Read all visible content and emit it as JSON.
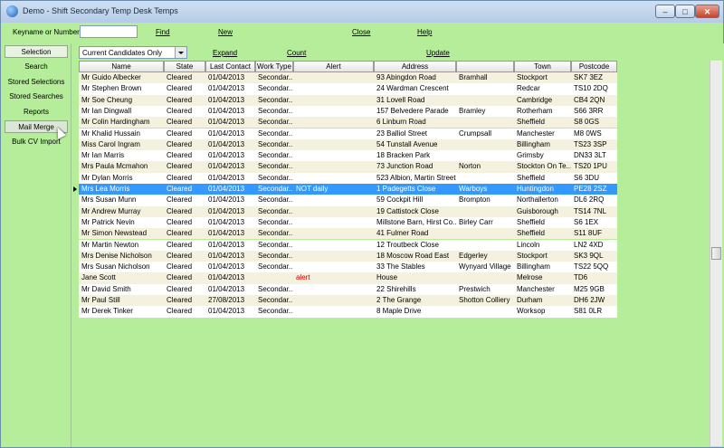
{
  "window": {
    "title": "Demo - Shift Secondary Temp Desk Temps",
    "minimize": "–",
    "maximize": "□",
    "close": "✕"
  },
  "toolbar": {
    "keyword_label": "Keyname or Number",
    "keyword_value": "",
    "find": "Find",
    "new": "New",
    "close": "Close",
    "help": "Help"
  },
  "sidebar": {
    "items": [
      "Selection",
      "Search",
      "Stored Selections",
      "Stored Searches",
      "Reports",
      "Mail Merge",
      "Bulk CV Import"
    ]
  },
  "filters": {
    "candidates_select": "Current Candidates Only",
    "expand": "Expand",
    "count": "Count",
    "update": "Update"
  },
  "table": {
    "columns": [
      "Name",
      "State",
      "Last Contact",
      "Work Type",
      "Alert",
      "Address",
      "",
      "Town",
      "Postcode"
    ],
    "rows": [
      [
        "Mr Guido Albecker",
        "Cleared",
        "01/04/2013",
        "Secondar...",
        "",
        "93 Abingdon Road",
        "Bramhall",
        "Stockport",
        "SK7 3EZ"
      ],
      [
        "Mr Stephen Brown",
        "Cleared",
        "01/04/2013",
        "Secondar...",
        "",
        "24 Wardman Crescent",
        "",
        "Redcar",
        "TS10 2DQ"
      ],
      [
        "Mr Soe Cheung",
        "Cleared",
        "01/04/2013",
        "Secondar...",
        "",
        "31 Lovell Road",
        "",
        "Cambridge",
        "CB4 2QN"
      ],
      [
        "Mr Ian Dingwall",
        "Cleared",
        "01/04/2013",
        "Secondar...",
        "",
        "157 Belvedere Parade",
        "Bramley",
        "Rotherham",
        "S66 3RR"
      ],
      [
        "Mr Colin Hardingham",
        "Cleared",
        "01/04/2013",
        "Secondar...",
        "",
        "6 Linburn Road",
        "",
        "Sheffield",
        "S8 0GS"
      ],
      [
        "Mr Khalid Hussain",
        "Cleared",
        "01/04/2013",
        "Secondar...",
        "",
        "23 Balliol Street",
        "Crumpsall",
        "Manchester",
        "M8 0WS"
      ],
      [
        "Miss Carol Ingram",
        "Cleared",
        "01/04/2013",
        "Secondar...",
        "",
        "54 Tunstall Avenue",
        "",
        "Billingham",
        "TS23 3SP"
      ],
      [
        "Mr Ian Marris",
        "Cleared",
        "01/04/2013",
        "Secondar...",
        "",
        "18 Bracken Park",
        "",
        "Grimsby",
        "DN33 3LT"
      ],
      [
        "Mrs Paula Mcmahon",
        "Cleared",
        "01/04/2013",
        "Secondar...",
        "",
        "73 Junction Road",
        "Norton",
        "Stockton On Te...",
        "TS20 1PU"
      ],
      [
        "Mr Dylan Morris",
        "Cleared",
        "01/04/2013",
        "Secondar...",
        "",
        "523 Albion, Martin Street",
        "",
        "Sheffield",
        "S6 3DU"
      ],
      [
        "Mrs Lea Morris",
        "Cleared",
        "01/04/2013",
        "Secondar...",
        "NOT daily",
        "1 Padegetts Close",
        "Warboys",
        "Huntingdon",
        "PE28 2SZ"
      ],
      [
        "Mrs Susan Munn",
        "Cleared",
        "01/04/2013",
        "Secondar...",
        "",
        "59 Cockpit Hill",
        "Brompton",
        "Northallerton",
        "DL6 2RQ"
      ],
      [
        "Mr Andrew Murray",
        "Cleared",
        "01/04/2013",
        "Secondar...",
        "",
        "19 Cattistock Close",
        "",
        "Guisborough",
        "TS14 7NL"
      ],
      [
        "Mr Patrick Nevin",
        "Cleared",
        "01/04/2013",
        "Secondar...",
        "",
        "Millstone Barn, Hirst Co...",
        "Birley Carr",
        "Sheffield",
        "S6 1EX"
      ],
      [
        "Mr Simon Newstead",
        "Cleared",
        "01/04/2013",
        "Secondar...",
        "",
        "41 Fulmer Road",
        "",
        "Sheffield",
        "S11 8UF"
      ],
      [
        "Mr Martin Newton",
        "Cleared",
        "01/04/2013",
        "Secondar...",
        "",
        "12 Troutbeck Close",
        "",
        "Lincoln",
        "LN2 4XD"
      ],
      [
        "Mrs Denise Nicholson",
        "Cleared",
        "01/04/2013",
        "Secondar...",
        "",
        "18 Moscow Road East",
        "Edgerley",
        "Stockport",
        "SK3 9QL"
      ],
      [
        "Mrs Susan Nicholson",
        "Cleared",
        "01/04/2013",
        "Secondar...",
        "",
        "33 The Stables",
        "Wynyard Village",
        "Billingham",
        "TS22 5QQ"
      ],
      [
        "Jane Scott",
        "Cleared",
        "01/04/2013",
        "",
        "alert",
        "House",
        "",
        "Melrose",
        "TD6"
      ],
      [
        "Mr David Smith",
        "Cleared",
        "01/04/2013",
        "Secondar...",
        "",
        "22 Shirehills",
        "Prestwich",
        "Manchester",
        "M25 9GB"
      ],
      [
        "Mr Paul Still",
        "Cleared",
        "27/08/2013",
        "Secondar...",
        "",
        "2 The Grange",
        "Shotton Colliery",
        "Durham",
        "DH6 2JW"
      ],
      [
        "Mr Derek Tinker",
        "Cleared",
        "01/04/2013",
        "Secondar...",
        "",
        "8 Maple Drive",
        "",
        "Worksop",
        "S81 0LR"
      ]
    ],
    "selected_index": 10,
    "alert_red_index": 18
  }
}
